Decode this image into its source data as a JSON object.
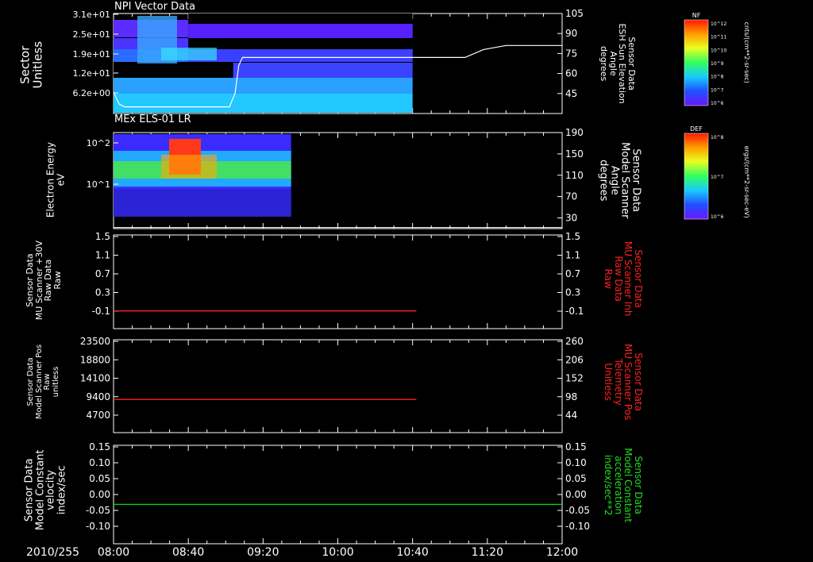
{
  "footer": {
    "date": "2010/255"
  },
  "x_ticks": [
    "08:00",
    "08:40",
    "09:20",
    "10:00",
    "10:40",
    "11:20",
    "12:00"
  ],
  "colors": {
    "background": "#000000",
    "axis": "#ffffff",
    "red_trace": "#ff2020",
    "green_trace": "#00dd00",
    "elev_trace": "#ffffff"
  },
  "colorbars": [
    {
      "title": "NF",
      "ticks": [
        "10^12",
        "10^11",
        "10^10",
        "10^9",
        "10^8",
        "10^7",
        "10^6"
      ],
      "unit": "cnts/(cm**2-sr-sec)"
    },
    {
      "title": "DEF",
      "ticks": [
        "10^8",
        "10^7",
        "10^6"
      ],
      "unit": "ergs/(cm**2-sr-sec-eV)"
    }
  ],
  "chart_data": [
    {
      "type": "heatmap",
      "title": "NPI Vector Data",
      "ylabel": [
        "Sector",
        "Unitless"
      ],
      "yticks": [
        "3.1e+01",
        "2.5e+01",
        "1.9e+01",
        "1.2e+01",
        "6.2e+00"
      ],
      "x_range": [
        "08:00",
        "10:40"
      ],
      "right_axis": {
        "label": [
          "Sensor Data",
          "ESH Sun Elevation",
          "Angle",
          "degrees"
        ],
        "ticks": [
          105,
          90,
          75,
          60,
          45
        ],
        "ylim": [
          30,
          105
        ],
        "series": {
          "name": "ESH Sun Elevation Angle",
          "x": [
            "08:00",
            "08:03",
            "08:06",
            "08:40",
            "09:02",
            "09:05",
            "09:07",
            "09:09",
            "11:00",
            "11:08",
            "11:18",
            "11:30",
            "12:00"
          ],
          "values": [
            46,
            37,
            35,
            35,
            35,
            45,
            66,
            72,
            72,
            72,
            78,
            81,
            81
          ]
        }
      }
    },
    {
      "type": "heatmap",
      "title": "MEx ELS-01 LR",
      "ylabel": [
        "Electron Energy",
        "eV"
      ],
      "yticks": [
        "10^2",
        "10^1"
      ],
      "x_range": [
        "08:00",
        "09:35"
      ],
      "right_axis": {
        "label": [
          "Sensor Data",
          "Model Scanner",
          "Angle",
          "degrees"
        ],
        "ticks": [
          190,
          150,
          110,
          70,
          30
        ],
        "ylim": [
          10,
          190
        ],
        "series": {
          "name": "Model Scanner Angle",
          "x": [
            "08:00",
            "12:00"
          ],
          "values": [
            12,
            12
          ]
        }
      }
    },
    {
      "type": "line",
      "ylabel": [
        "Sensor Data",
        "MU Scanner +30V",
        "Raw Data",
        "Raw"
      ],
      "yticks": [
        "1.5",
        "1.1",
        "0.7",
        "0.3",
        "-0.1"
      ],
      "ylim": [
        -0.35,
        1.5
      ],
      "right_axis": {
        "label": [
          "Sensor Data",
          "MU Scanner Inh",
          "Raw Data",
          "Raw"
        ],
        "ticks": [
          "1.5",
          "1.1",
          "0.7",
          "0.3",
          "-0.1"
        ]
      },
      "series": [
        {
          "x": [
            "08:00",
            "10:42"
          ],
          "values": [
            0,
            0
          ]
        }
      ]
    },
    {
      "type": "line",
      "ylabel": [
        "Sensor Data",
        "Model Scanner Pos",
        "Raw",
        "unitless"
      ],
      "yticks": [
        "23500",
        "18800",
        "14100",
        "9400",
        "4700"
      ],
      "ylim": [
        0,
        23500
      ],
      "right_axis": {
        "label": [
          "Sensor Data",
          "MU Scanner Pos",
          "Telemetry",
          "Unitless"
        ],
        "ticks": [
          "260",
          "206",
          "152",
          "98",
          "44"
        ]
      },
      "series": [
        {
          "x": [
            "08:00",
            "10:42"
          ],
          "values": [
            8400,
            8400
          ]
        }
      ]
    },
    {
      "type": "line",
      "ylabel": [
        "Sensor Data",
        "Model Constant",
        "velocity",
        "index/sec"
      ],
      "yticks": [
        "0.15",
        "0.10",
        "0.05",
        "0.00",
        "-0.05",
        "-0.10"
      ],
      "ylim": [
        -0.1,
        0.15
      ],
      "right_axis": {
        "label": [
          "Sensor Data",
          "Model Constant",
          "acceleration",
          "index/sec**2"
        ],
        "ticks": [
          "0.15",
          "0.10",
          "0.05",
          "0.00",
          "-0.05",
          "-0.10"
        ]
      },
      "series": [
        {
          "x": [
            "08:00",
            "12:00"
          ],
          "values": [
            0,
            0
          ]
        }
      ]
    }
  ]
}
